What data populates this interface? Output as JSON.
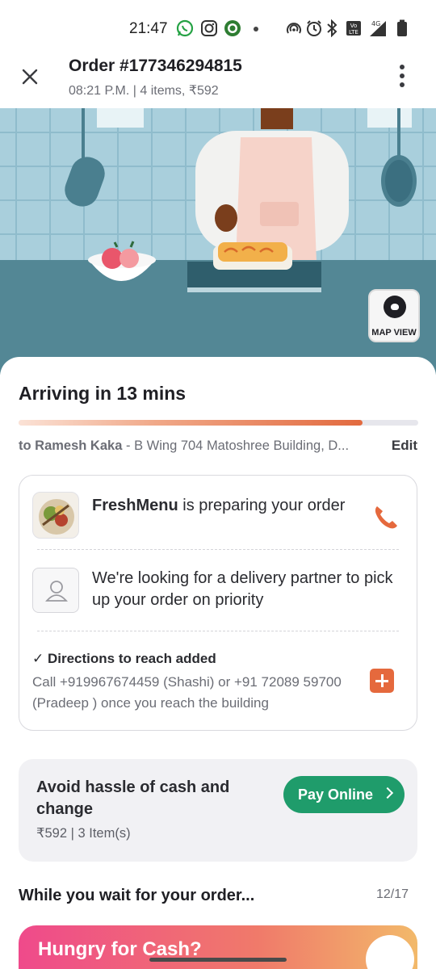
{
  "status_bar": {
    "time": "21:47",
    "icons": [
      "whatsapp-icon",
      "instagram-icon",
      "app-icon",
      "dot-icon",
      "hotspot-icon",
      "alarm-icon",
      "bluetooth-icon",
      "volte-icon",
      "signal-icon",
      "battery-icon"
    ],
    "network": "4G"
  },
  "header": {
    "title": "Order #177346294815",
    "subtitle": "08:21 P.M. | 4 items, ₹592"
  },
  "hero": {
    "map_view_label": "MAP VIEW"
  },
  "tracking": {
    "eta_text": "Arriving in 13 mins",
    "progress": 0.86,
    "recipient": "to Ramesh Kaka",
    "separator": " - ",
    "address": "B Wing 704 Matoshree Building, D...",
    "edit_label": "Edit"
  },
  "status_card": {
    "restaurant_name": "FreshMenu",
    "restaurant_status": " is preparing your order",
    "partner_text": "We're looking for a delivery partner to pick up your order on priority",
    "directions_title": "✓ Directions to reach added",
    "directions_body": "Call +919967674459 (Shashi) or +91 72089 59700 (Pradeep ) once you reach the building"
  },
  "pay_card": {
    "title": "Avoid hassle of cash and change",
    "summary": "₹592 | 3 Item(s)",
    "button_label": "Pay Online"
  },
  "carousel": {
    "title": "While you wait for your order...",
    "counter": "12/17",
    "promo_title": "Hungry for Cash?"
  },
  "colors": {
    "accent_orange": "#e5693d",
    "pay_green": "#1f9c6b",
    "tile_blue": "#a9cfdc",
    "counter_teal": "#538795",
    "apron": "#f6d3c9"
  }
}
